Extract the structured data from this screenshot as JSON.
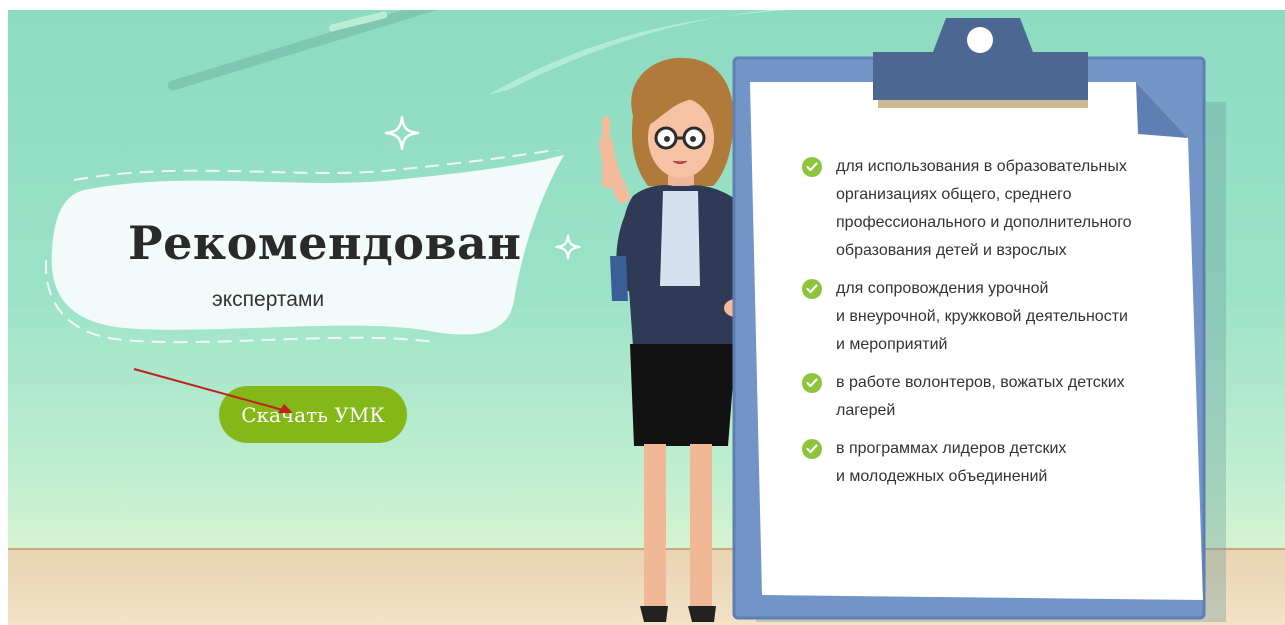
{
  "banner": {
    "title": "Рекомендован",
    "subtitle": "экспертами",
    "cta_label": "Скачать УМК"
  },
  "recommendations": [
    {
      "lines": [
        "для использования в образовательных",
        "организациях общего, среднего",
        "профессионального и дополнительного",
        "образования детей и взрослых"
      ]
    },
    {
      "lines": [
        "для сопровождения урочной",
        "и внеурочной, кружковой деятельности",
        "и мероприятий"
      ]
    },
    {
      "lines": [
        "в работе волонтеров, вожатых детских",
        "лагерей"
      ]
    },
    {
      "lines": [
        "в программах лидеров детских",
        "и молодежных объединений"
      ]
    }
  ],
  "icons": {
    "check": "check-circle-icon",
    "sparkle": "sparkle-icon",
    "pointer": "red-arrow-annotation"
  },
  "colors": {
    "background": "#93dfc4",
    "cta": "#84b718",
    "check": "#8cc43b",
    "clipboard": "#5f7fb3",
    "clip": "#4c6892",
    "arrow": "#c0221b"
  }
}
